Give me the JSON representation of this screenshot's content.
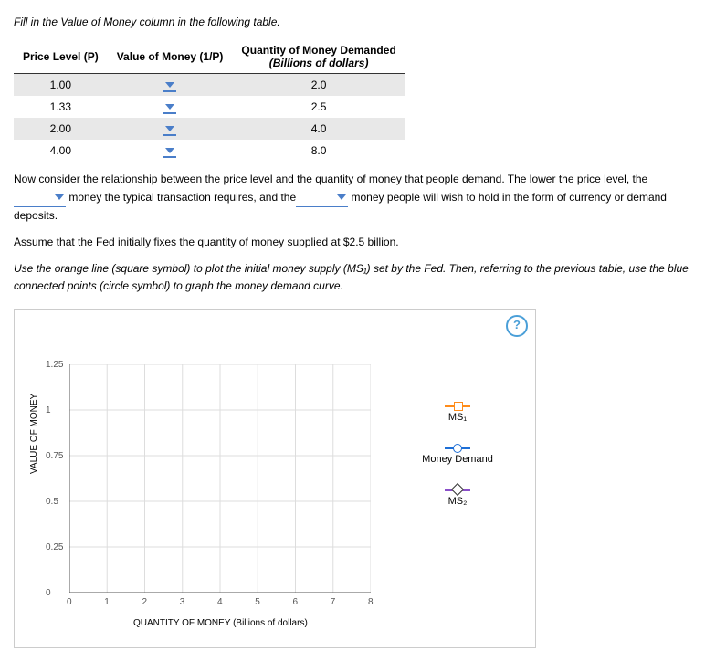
{
  "intro": "Fill in the Value of Money column in the following table.",
  "table": {
    "h1": "Price Level (P)",
    "h2": "Value of Money (1/P)",
    "h3a": "Quantity of Money Demanded",
    "h3b": "(Billions of dollars)",
    "rows": [
      {
        "p": "1.00",
        "q": "2.0"
      },
      {
        "p": "1.33",
        "q": "2.5"
      },
      {
        "p": "2.00",
        "q": "4.0"
      },
      {
        "p": "4.00",
        "q": "8.0"
      }
    ]
  },
  "para1a": "Now consider the relationship between the price level and the quantity of money that people demand. The lower the price level, the",
  "para1b": " money the typical transaction requires, and the",
  "para1c": " money people will wish to hold in the form of currency or demand deposits.",
  "para2": "Assume that the Fed initially fixes the quantity of money supplied at $2.5 billion.",
  "para3": "Use the orange line (square symbol) to plot the initial money supply (MS₁) set by the Fed. Then, referring to the previous table, use the blue connected points (circle symbol) to graph the money demand curve.",
  "legend": {
    "ms1": "MS₁",
    "md": "Money Demand",
    "ms2": "MS₂"
  },
  "help": "?",
  "chart_data": {
    "type": "scatter",
    "title": "",
    "xlabel": "QUANTITY OF MONEY (Billions of dollars)",
    "ylabel": "VALUE OF MONEY",
    "xlim": [
      0,
      8
    ],
    "ylim": [
      0,
      1.25
    ],
    "xticks": [
      0,
      1,
      2,
      3,
      4,
      5,
      6,
      7,
      8
    ],
    "yticks": [
      0,
      0.25,
      0.5,
      0.75,
      1.0,
      1.25
    ],
    "series": [
      {
        "name": "MS₁",
        "symbol": "square",
        "color": "#ff8c1a"
      },
      {
        "name": "Money Demand",
        "symbol": "circle",
        "color": "#1e6fd6"
      },
      {
        "name": "MS₂",
        "symbol": "diamond",
        "color": "#8a4fc9"
      }
    ]
  }
}
